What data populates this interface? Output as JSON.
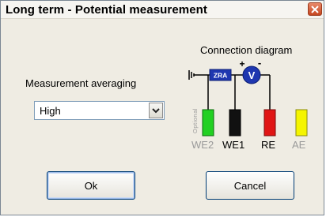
{
  "window": {
    "title": "Long term - Potential measurement"
  },
  "averaging": {
    "label": "Measurement averaging",
    "selected": "High"
  },
  "diagram": {
    "title": "Connection diagram",
    "optional_label": "Optional",
    "resistor_label": "ZRA",
    "voltmeter_symbol": "V",
    "plus_sign": "+",
    "minus_sign": "-",
    "electrodes": [
      {
        "label": "WE2",
        "color": "#22d022"
      },
      {
        "label": "WE1",
        "color": "#111111"
      },
      {
        "label": "RE",
        "color": "#e01515"
      },
      {
        "label": "AE",
        "color": "#f5f500"
      }
    ]
  },
  "buttons": {
    "ok": "Ok",
    "cancel": "Cancel"
  }
}
